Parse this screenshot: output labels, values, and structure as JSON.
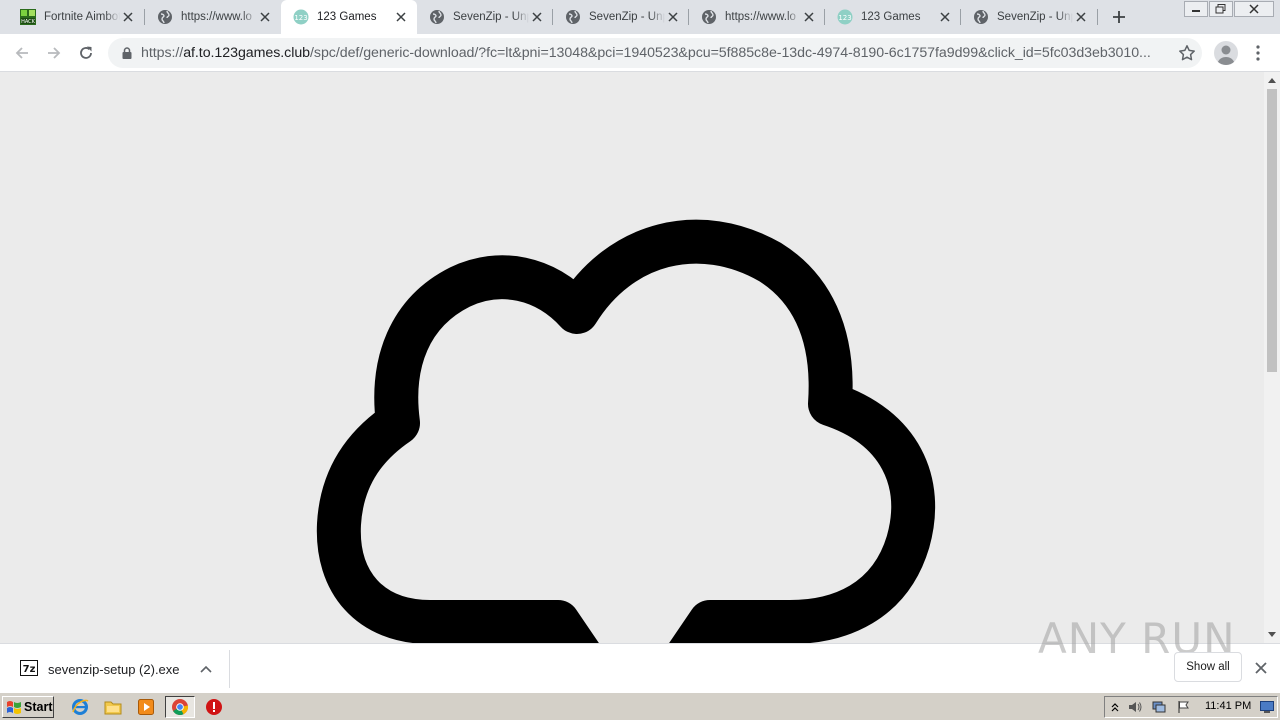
{
  "tabs": [
    {
      "title": "Fortnite Aimbot",
      "favicon": "fortnite-hack-icon",
      "active": false
    },
    {
      "title": "https://www.lo",
      "favicon": "globe-icon",
      "active": false
    },
    {
      "title": "123 Games",
      "favicon": "123games-icon",
      "active": true
    },
    {
      "title": "SevenZip - Unp",
      "favicon": "globe-icon",
      "active": false
    },
    {
      "title": "SevenZip - Unp",
      "favicon": "globe-icon",
      "active": false
    },
    {
      "title": "https://www.lo",
      "favicon": "globe-icon",
      "active": false
    },
    {
      "title": "123 Games",
      "favicon": "123games-icon",
      "active": false
    },
    {
      "title": "SevenZip - Unp",
      "favicon": "globe-icon",
      "active": false
    }
  ],
  "omnibox": {
    "scheme": "https://",
    "host": "af.to.123games.club",
    "path": "/spc/def/generic-download/?fc=lt&pni=13048&pci=1940523&pcu=5f885c8e-13dc-4974-8190-6c1757fa9d99&click_id=5fc03d3eb3010..."
  },
  "page": {
    "illustration": "cloud-download-icon",
    "background": "#ebebeb"
  },
  "download_shelf": {
    "file_name": "sevenzip-setup (2).exe",
    "file_icon": "7zip-icon",
    "show_all_label": "Show all"
  },
  "watermark": {
    "text": "ANY RUN"
  },
  "taskbar": {
    "start_label": "Start",
    "clock": "11:41 PM"
  },
  "colors": {
    "tab_strip": "#dee1e6",
    "omnibox": "#f1f3f4",
    "content_bg": "#ebebeb",
    "taskbar": "#d4d0c8"
  }
}
